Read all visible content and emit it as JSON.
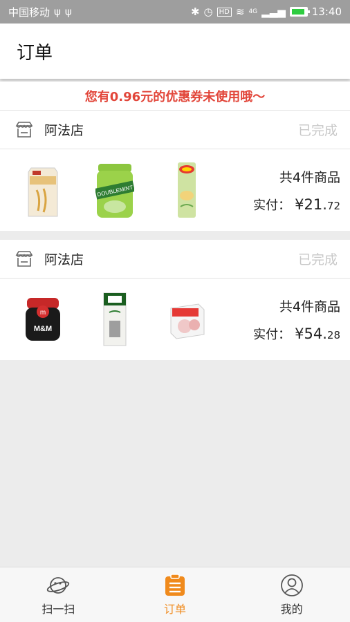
{
  "status_bar": {
    "carrier": "中国移动",
    "icons_left": [
      "usb-icon",
      "usb-icon"
    ],
    "icons_right": [
      "bluetooth-icon",
      "alarm-icon",
      "hd-icon",
      "wifi-icon",
      "signal-icon",
      "battery-icon"
    ],
    "network": "4G",
    "time": "13:40"
  },
  "header": {
    "title": "订单"
  },
  "coupon": {
    "text": "您有0.96元的优惠券未使用哦～"
  },
  "orders": [
    {
      "store": "阿法店",
      "status": "已完成",
      "products": [
        "milk-carton",
        "doublemint-gum",
        "lays-chips"
      ],
      "count_text": "共4件商品",
      "paid_label": "实付：",
      "price_main": "¥21.",
      "price_decimal": "72"
    },
    {
      "store": "阿法店",
      "status": "已完成",
      "products": [
        "mms-candy-jar",
        "jindian-milk",
        "cookie-box"
      ],
      "count_text": "共4件商品",
      "paid_label": "实付：",
      "price_main": "¥54.",
      "price_decimal": "28"
    }
  ],
  "tabbar": {
    "items": [
      {
        "label": "扫一扫",
        "icon": "planet-scan-icon"
      },
      {
        "label": "订单",
        "icon": "clipboard-icon",
        "active": true
      },
      {
        "label": "我的",
        "icon": "user-icon"
      }
    ]
  },
  "colors": {
    "accent": "#f08a1c",
    "coupon": "#e2463a",
    "status_done": "#c8c8c8",
    "background": "#ececec"
  }
}
